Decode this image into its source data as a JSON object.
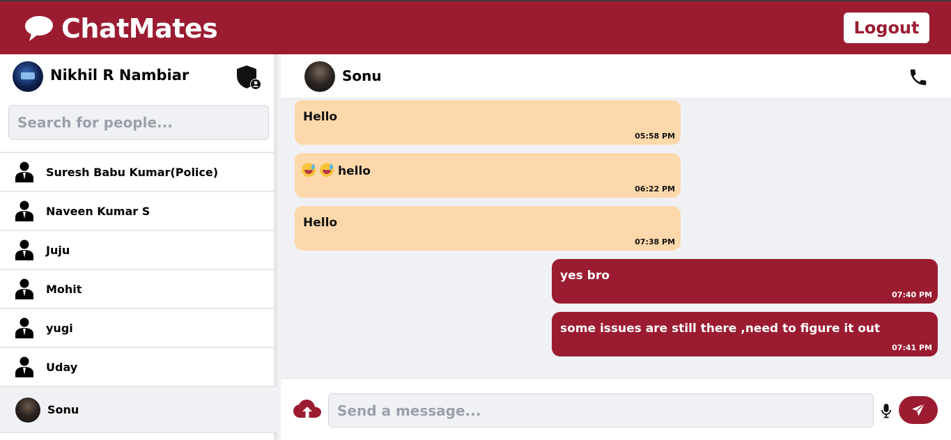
{
  "app": {
    "name": "ChatMates",
    "logout_label": "Logout",
    "accent": "#9b1c31"
  },
  "sidebar": {
    "me": {
      "name": "Nikhil R Nambiar"
    },
    "search": {
      "placeholder": "Search for people..."
    },
    "contacts": [
      {
        "name": "Suresh Babu Kumar(Police)",
        "icon": "person-icon"
      },
      {
        "name": "Naveen Kumar S",
        "icon": "person-icon"
      },
      {
        "name": "Juju",
        "icon": "person-icon"
      },
      {
        "name": "Mohit",
        "icon": "person-icon"
      },
      {
        "name": "yugi",
        "icon": "person-icon"
      },
      {
        "name": "Uday",
        "icon": "person-icon"
      },
      {
        "name": "Sonu",
        "icon": "photo-avatar",
        "active": true
      }
    ]
  },
  "chat": {
    "peer": {
      "name": "Sonu"
    },
    "messages": [
      {
        "direction": "in",
        "text": "Hello",
        "time": "05:58 PM"
      },
      {
        "direction": "in",
        "text": "hello",
        "emoji_prefix": "2x smiling-emoji",
        "time": "06:22 PM"
      },
      {
        "direction": "in",
        "text": "Hello",
        "time": "07:38 PM"
      },
      {
        "direction": "out",
        "text": "yes bro",
        "time": "07:40 PM"
      },
      {
        "direction": "out",
        "text": "some issues are still there ,need to figure it out",
        "time": "07:41 PM"
      }
    ],
    "composer": {
      "placeholder": "Send a message..."
    }
  }
}
